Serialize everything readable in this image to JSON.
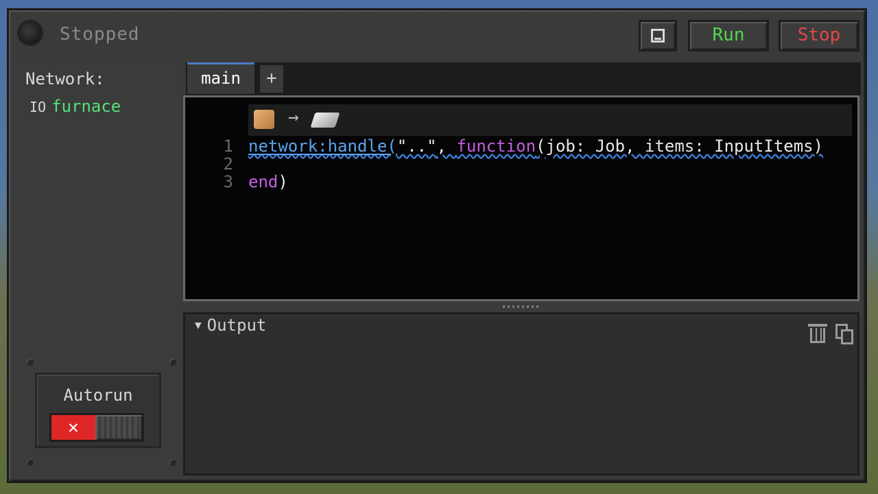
{
  "status": {
    "text": "Stopped"
  },
  "toolbar": {
    "book_icon": "book-icon",
    "run_label": "Run",
    "stop_label": "Stop"
  },
  "sidebar": {
    "network_label": "Network:",
    "devices": [
      {
        "kind": "IO",
        "name": "furnace"
      }
    ],
    "autorun_label": "Autorun",
    "autorun_toggle": {
      "state": "off",
      "off_glyph": "✕"
    }
  },
  "tabs": [
    {
      "label": "main"
    }
  ],
  "tab_add_label": "+",
  "editor": {
    "recipe_hint": {
      "input_icon": "ore-icon",
      "arrow": "→",
      "output_icon": "ingot-icon"
    },
    "lines": [
      {
        "number": "1",
        "tokens": [
          {
            "text": "network:handle(",
            "kind": "fn"
          },
          {
            "text": "\"..\"",
            "kind": "str"
          },
          {
            "text": ", ",
            "kind": "param"
          },
          {
            "text": "function",
            "kind": "kw"
          },
          {
            "text": "(job: Job, items: InputItems)",
            "kind": "param"
          }
        ]
      },
      {
        "number": "2",
        "tokens": []
      },
      {
        "number": "3",
        "tokens": [
          {
            "text": "end",
            "kind": "end"
          },
          {
            "text": ")",
            "kind": "param"
          }
        ]
      }
    ]
  },
  "output": {
    "title": "Output",
    "caret": "▼",
    "clear_icon": "trash-icon",
    "copy_icon": "copy-icon"
  },
  "colors": {
    "run": "#4fd84f",
    "stop": "#e34848",
    "device": "#55e07a",
    "keyword": "#c65de3",
    "function": "#5aa3f0",
    "toggle_off": "#e02727"
  }
}
